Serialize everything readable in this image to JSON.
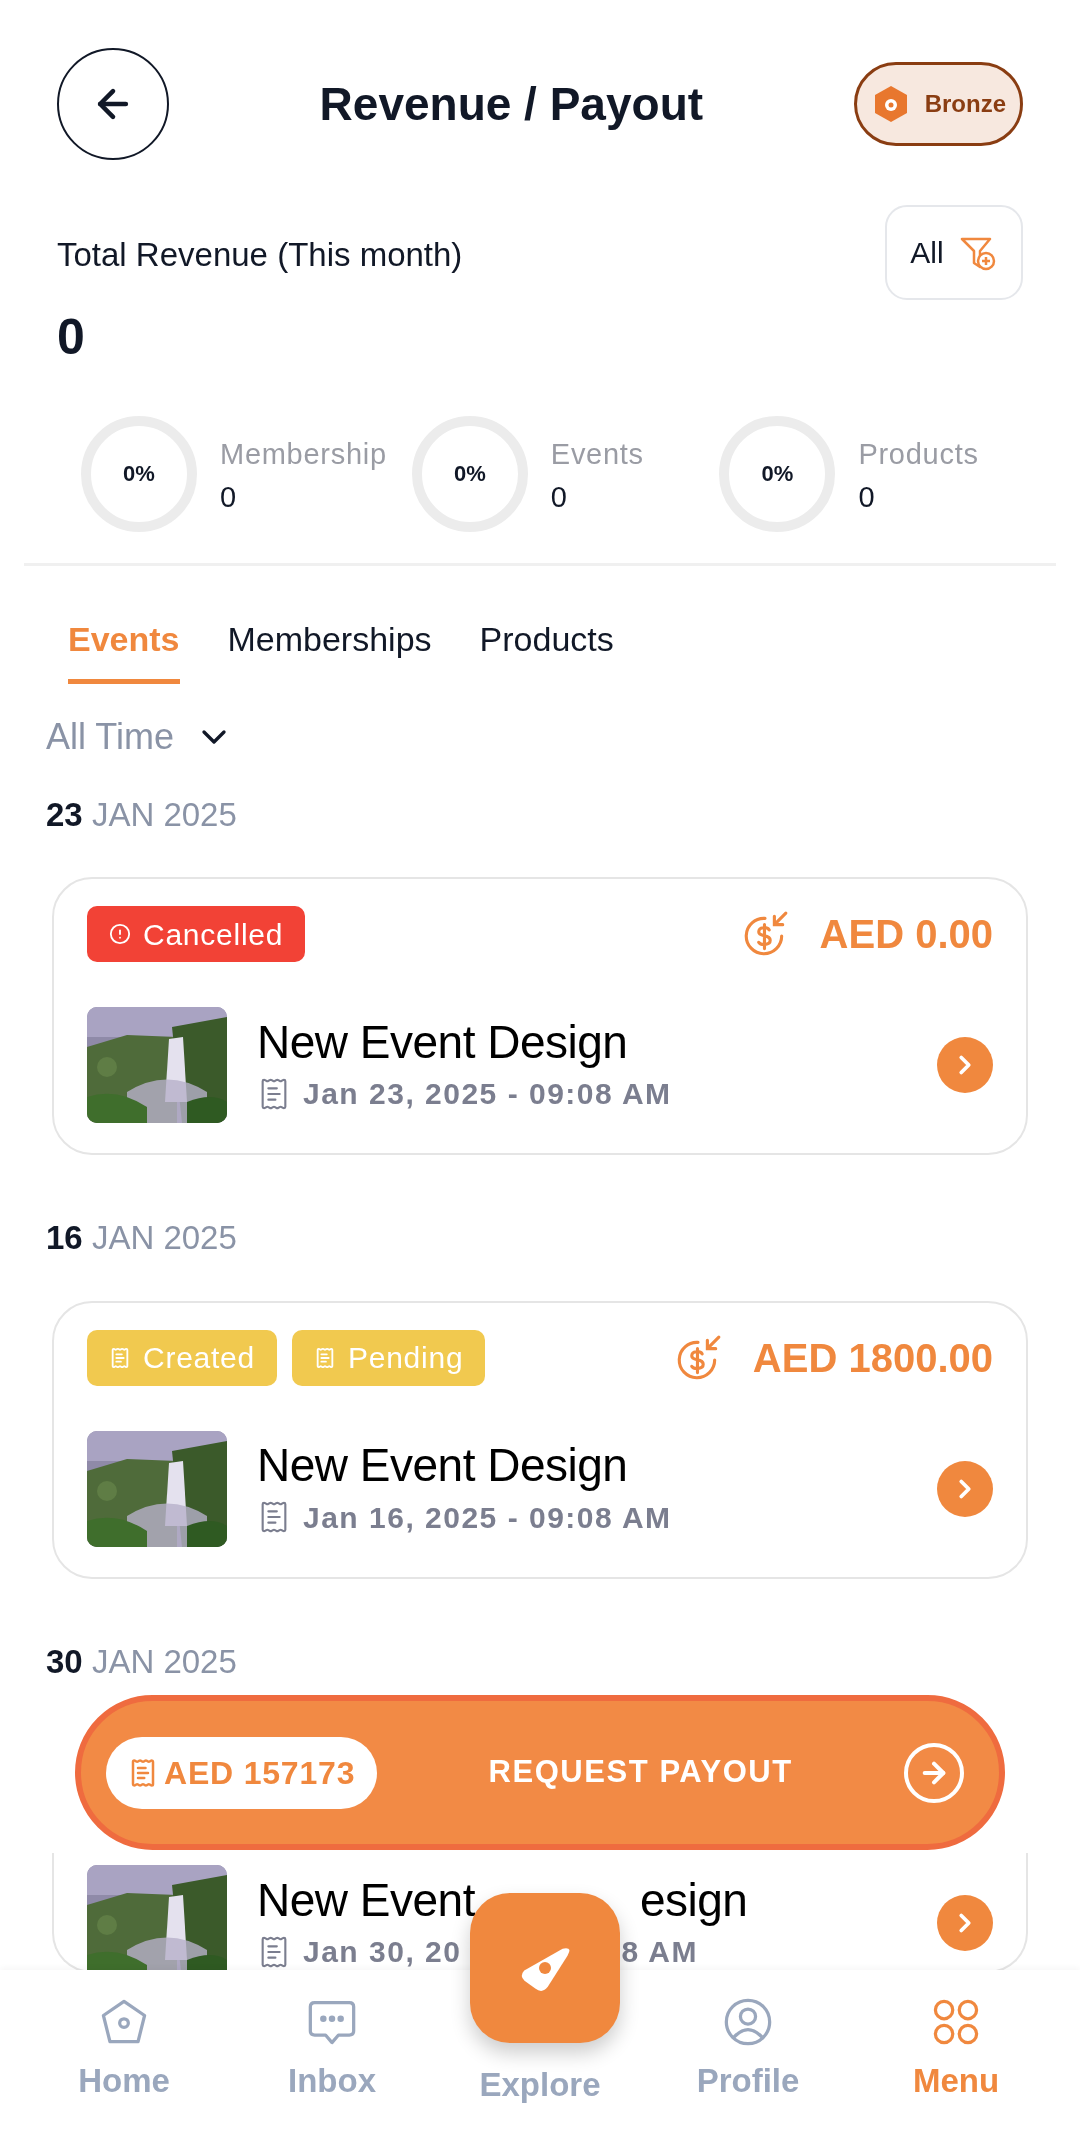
{
  "header": {
    "title": "Revenue / Payout",
    "badge": "Bronze"
  },
  "summary": {
    "label": "Total Revenue (This month)",
    "value": "0",
    "filter": "All",
    "breakdown": [
      {
        "percent": "0%",
        "label": "Membership",
        "value": "0",
        "level": 0
      },
      {
        "percent": "0%",
        "label": "Events",
        "value": "0",
        "level": 0
      },
      {
        "percent": "0%",
        "label": "Products",
        "value": "0",
        "level": 0
      }
    ]
  },
  "tabs": [
    {
      "label": "Events",
      "selected": true
    },
    {
      "label": "Memberships",
      "selected": false
    },
    {
      "label": "Products",
      "selected": false
    }
  ],
  "period": "All Time",
  "groups": [
    {
      "day": "23",
      "month": "JAN 2025",
      "statuses": [
        {
          "label": "Cancelled",
          "kind": "cancelled"
        }
      ],
      "amount": "AED 0.00",
      "title": "New Event Design",
      "date": "Jan 23, 2025 - 09:08 AM"
    },
    {
      "day": "16",
      "month": "JAN 2025",
      "statuses": [
        {
          "label": "Created",
          "kind": "created"
        },
        {
          "label": "Pending",
          "kind": "pending"
        }
      ],
      "amount": "AED 1800.00",
      "title": "New Event Design",
      "date": "Jan 16, 2025 - 09:08 AM"
    },
    {
      "day": "30",
      "month": "JAN 2025",
      "title_parts": [
        "New Event",
        "esign"
      ],
      "date_parts": [
        "Jan 30, 20",
        "8 AM"
      ]
    }
  ],
  "payout": {
    "balance": "AED 157173",
    "action": "REQUEST PAYOUT"
  },
  "nav": [
    {
      "label": "Home",
      "kind": "home",
      "selected": false
    },
    {
      "label": "Inbox",
      "kind": "inbox",
      "selected": false
    },
    {
      "label": "Explore",
      "kind": "explore",
      "selected": false
    },
    {
      "label": "Profile",
      "kind": "profile",
      "selected": false
    },
    {
      "label": "Menu",
      "kind": "menu",
      "selected": true
    }
  ]
}
